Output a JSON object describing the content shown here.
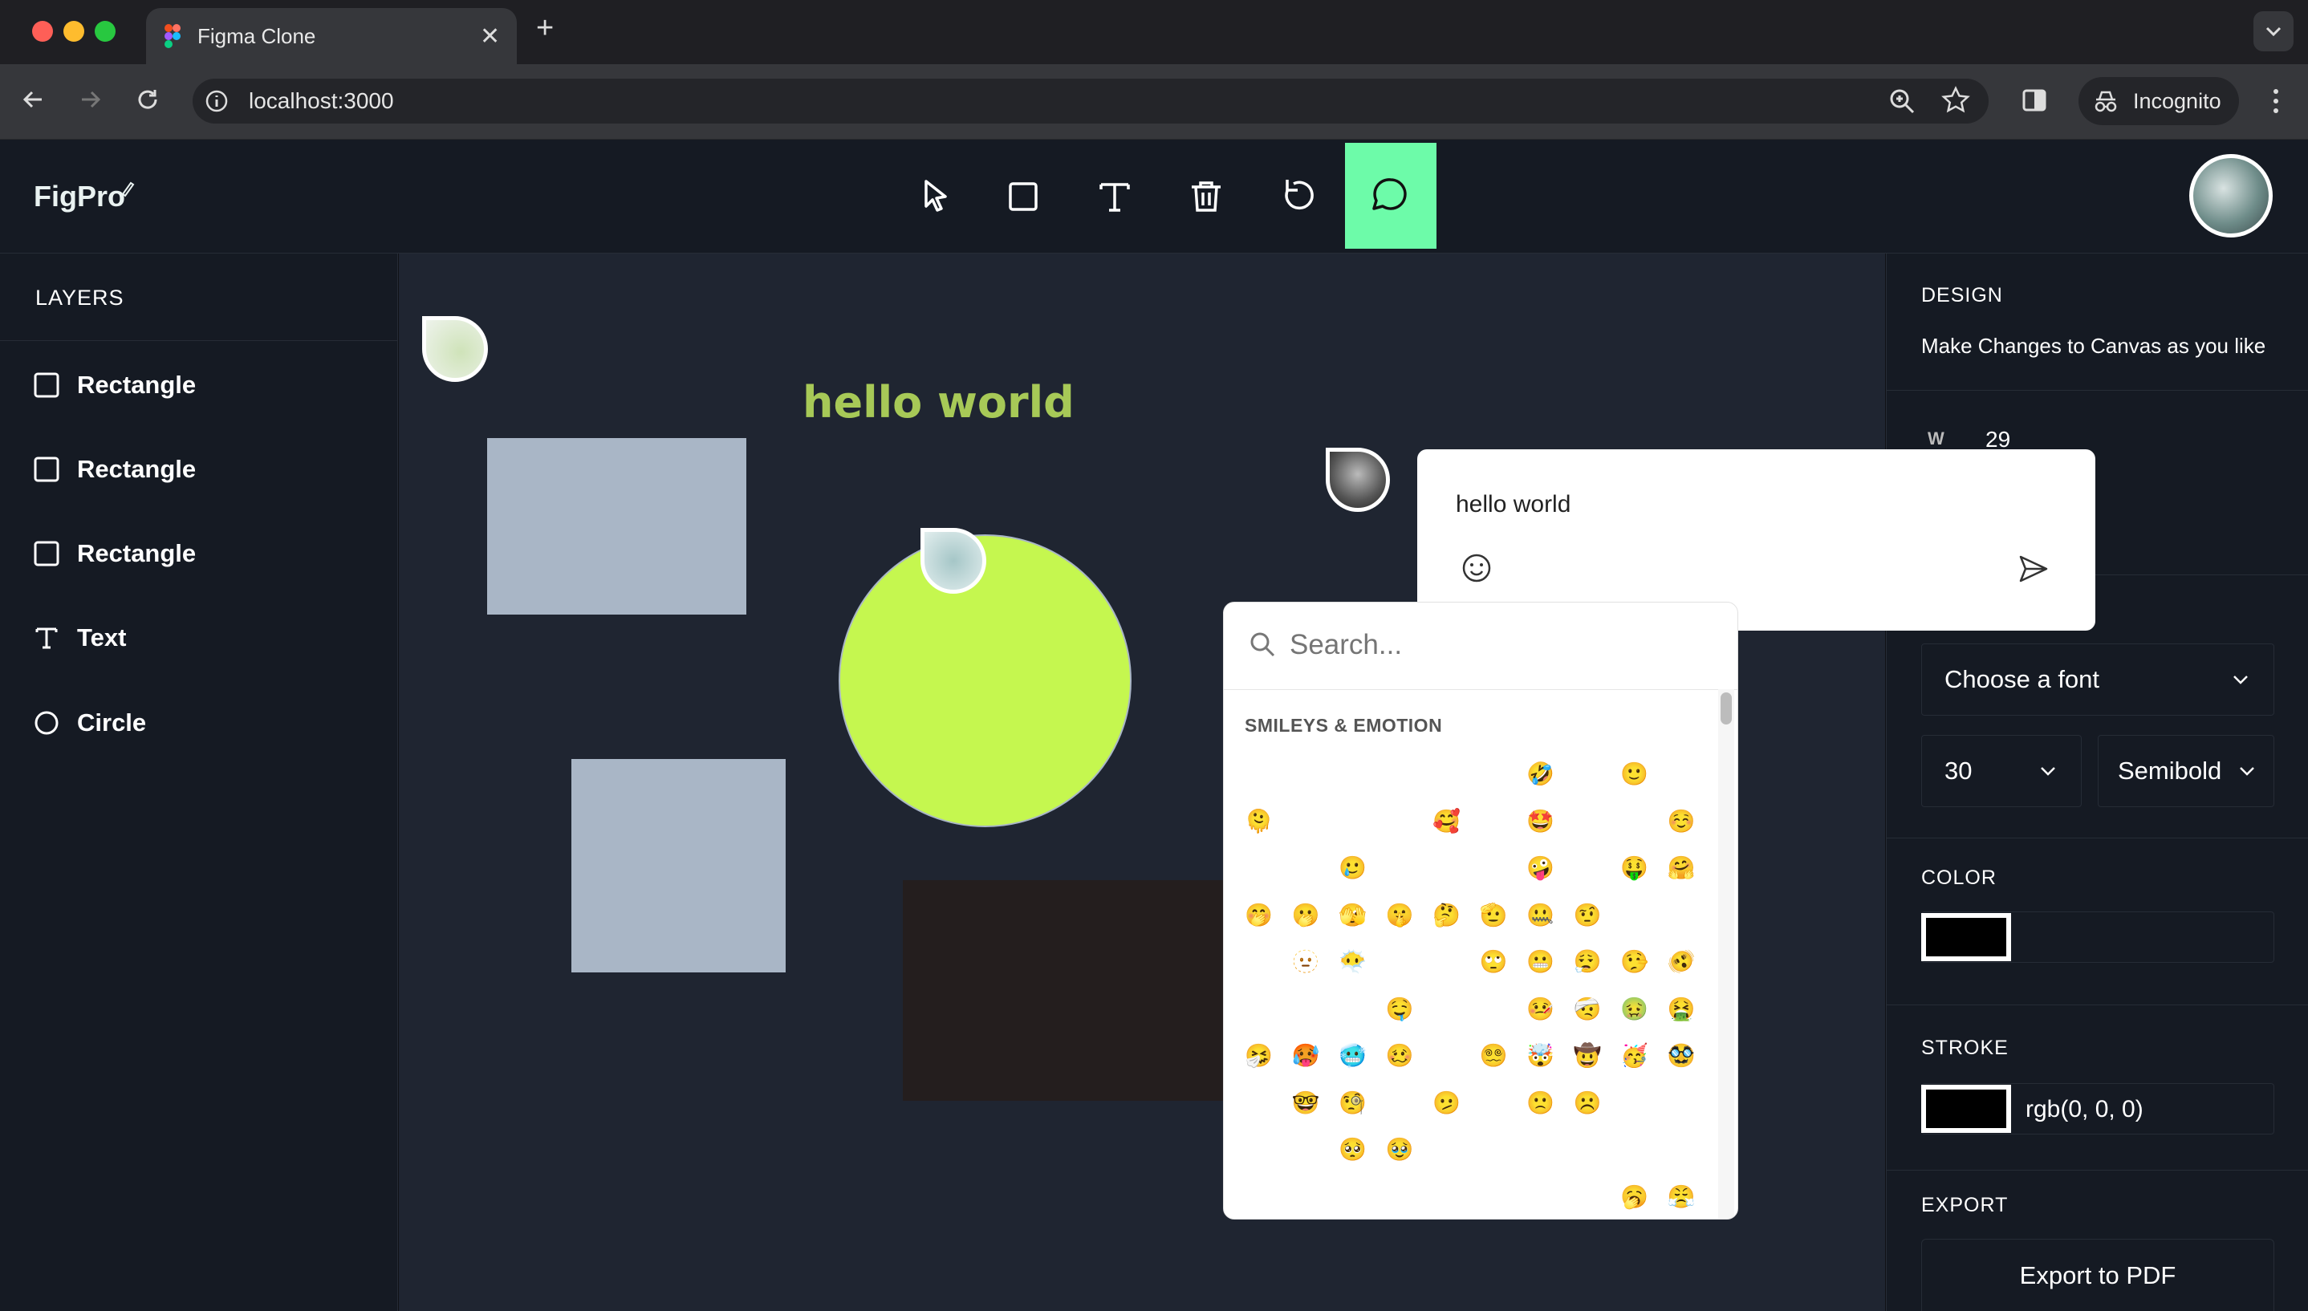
{
  "browser": {
    "tab_title": "Figma Clone",
    "url": "localhost:3000",
    "incognito_label": "Incognito"
  },
  "app": {
    "logo_text": "FigPro",
    "tools": [
      "select-icon",
      "rectangle-icon",
      "text-icon",
      "trash-icon",
      "reset-icon",
      "comment-icon"
    ],
    "active_tool": "comment-icon",
    "accent": "#6dfba9"
  },
  "layers": {
    "title": "LAYERS",
    "items": [
      {
        "label": "Rectangle",
        "icon": "rectangle-icon"
      },
      {
        "label": "Rectangle",
        "icon": "rectangle-icon"
      },
      {
        "label": "Rectangle",
        "icon": "rectangle-icon"
      },
      {
        "label": "Text",
        "icon": "text-icon"
      },
      {
        "label": "Circle",
        "icon": "circle-icon"
      }
    ]
  },
  "canvas": {
    "text_object": "hello world",
    "text_color": "#a7c957",
    "rect_color": "#a9b6c6",
    "circle_color": "#c5f74f",
    "dark_rect_color": "#241e1e"
  },
  "design": {
    "title": "DESIGN",
    "subtitle": "Make Changes to Canvas as you like",
    "w_label": "W",
    "w_value": "29",
    "font_placeholder": "Choose a font",
    "font_size": "30",
    "font_weight": "Semibold",
    "color_title": "COLOR",
    "color_value": "#000000",
    "stroke_title": "STROKE",
    "stroke_value": "rgb(0, 0, 0)",
    "export_title": "EXPORT",
    "export_button": "Export to PDF"
  },
  "comment": {
    "text": "hello world"
  },
  "emoji_picker": {
    "search_placeholder": "Search...",
    "category": "SMILEYS & EMOTION",
    "rows": [
      [
        "😀",
        "😃",
        "😄",
        "😁",
        "😆",
        "😅",
        "🤣",
        "😂",
        "🙂",
        "🙃"
      ],
      [
        "🫠",
        "😉",
        "😊",
        "😇",
        "🥰",
        "😍",
        "🤩",
        "😘",
        "😗",
        "☺️"
      ],
      [
        "😚",
        "😙",
        "🥲",
        "😋",
        "😛",
        "😜",
        "🤪",
        "😝",
        "🤑",
        "🤗"
      ],
      [
        "🤭",
        "🫢",
        "🫣",
        "🤫",
        "🤔",
        "🫡",
        "🤐",
        "🤨",
        "😐",
        "😑"
      ],
      [
        "😶",
        "🫥",
        "😶‍🌫️",
        "😏",
        "😒",
        "🙄",
        "😬",
        "😮‍💨",
        "🤥",
        "🫨"
      ],
      [
        "😌",
        "😔",
        "😪",
        "🤤",
        "😴",
        "😷",
        "🤒",
        "🤕",
        "🤢",
        "🤮"
      ],
      [
        "🤧",
        "🥵",
        "🥶",
        "🥴",
        "😵",
        "😵‍💫",
        "🤯",
        "🤠",
        "🥳",
        "🥸"
      ],
      [
        "😎",
        "🤓",
        "🧐",
        "😕",
        "🫤",
        "😟",
        "🙁",
        "☹️",
        "😮",
        "😯"
      ],
      [
        "😲",
        "😳",
        "🥺",
        "🥹",
        "😦",
        "😧",
        "😨",
        "😰",
        "😥",
        "😢"
      ],
      [
        "😭",
        "😱",
        "😖",
        "😣",
        "😞",
        "😓",
        "😩",
        "😫",
        "🥱",
        "😤"
      ]
    ]
  }
}
